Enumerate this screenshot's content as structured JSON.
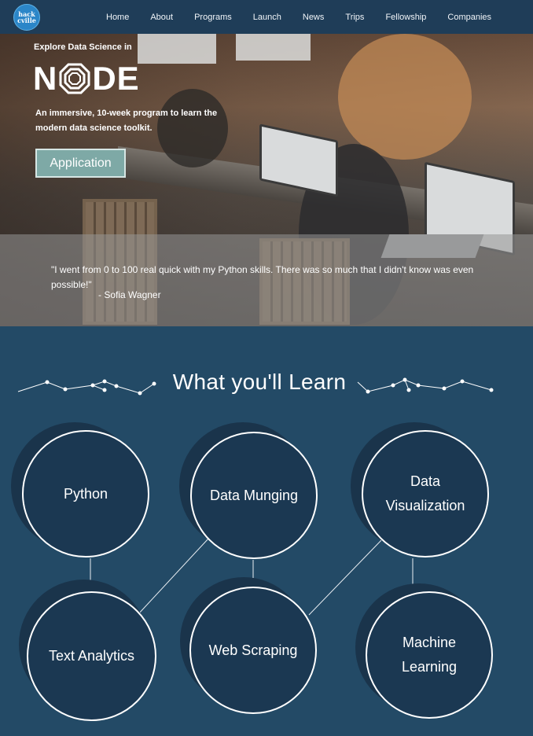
{
  "brand": {
    "logo_line1": "hack",
    "logo_line2": "cville"
  },
  "nav": [
    "Home",
    "About",
    "Programs",
    "Launch",
    "News",
    "Trips",
    "Fellowship",
    "Companies"
  ],
  "hero": {
    "kicker": "Explore Data Science in",
    "title_letters": [
      "N",
      "O",
      "DE"
    ],
    "subtitle": "An immersive, 10-week program to learn the modern data science toolkit.",
    "cta_label": "Application",
    "quote": "\"I went from 0 to 100 real quick with my Python skills. There was so much that I didn't know was even possible!\"",
    "quote_author": "- Sofia Wagner"
  },
  "learn": {
    "title": "What you'll Learn",
    "topics": [
      {
        "label": "Python"
      },
      {
        "label": "Data Munging"
      },
      {
        "label": "Data Visualization"
      },
      {
        "label": "Text Analytics"
      },
      {
        "label": "Web Scraping"
      },
      {
        "label": "Machine Learning"
      }
    ]
  },
  "colors": {
    "navbar": "#1f3d58",
    "section_bg": "#234a66",
    "bubble": "#1b3852",
    "cta": "#7ea9a6"
  }
}
